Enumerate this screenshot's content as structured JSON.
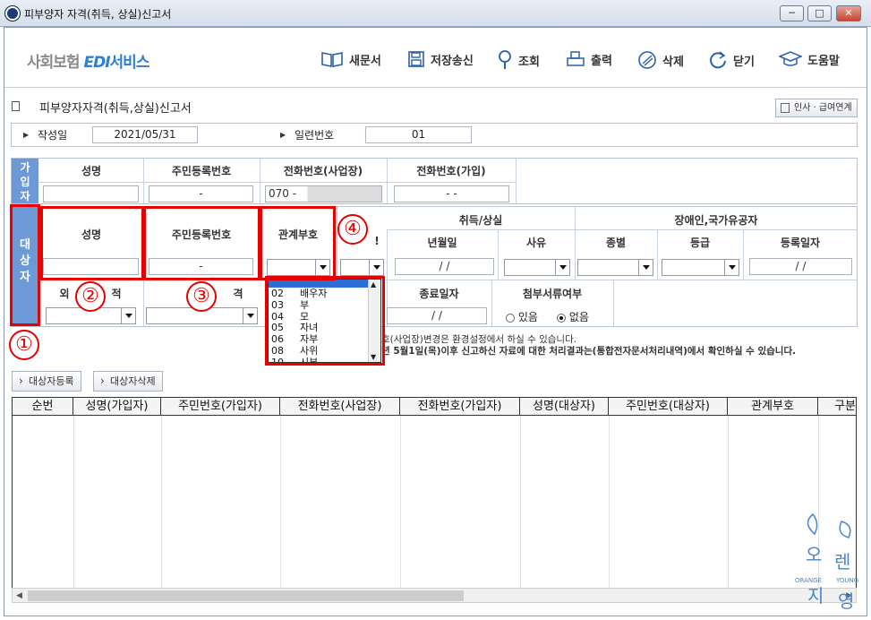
{
  "window": {
    "title": "피부양자 자격(취득, 상실)신고서",
    "buttons": [
      "─",
      "□",
      "✕"
    ]
  },
  "logo": {
    "prefix": "사회보험 ",
    "edi": "EDI",
    "suffix": "서비스"
  },
  "toolbar": [
    {
      "label": "새문서",
      "icon": "book-icon"
    },
    {
      "label": "저장송신",
      "icon": "save-icon"
    },
    {
      "label": "조회",
      "icon": "search-icon"
    },
    {
      "label": "출력",
      "icon": "print-icon"
    },
    {
      "label": "삭제",
      "icon": "delete-icon"
    },
    {
      "label": "닫기",
      "icon": "refresh-icon"
    },
    {
      "label": "도움말",
      "icon": "graduation-cap-icon"
    }
  ],
  "form": {
    "title": "피부양자자격(취득,상실)신고서",
    "link_button": "인사 · 급여연계",
    "created_label": "작성일",
    "created_value": "2021/05/31",
    "serial_label": "일련번호",
    "serial_value": "01"
  },
  "subscriber": {
    "side_label": "가입자",
    "headers": [
      "성명",
      "주민등록번호",
      "전화번호(사업장)",
      "전화번호(가입)"
    ],
    "rrn_value": "-",
    "phone_biz_prefix": "070  -",
    "phone_sub_value": "-        -"
  },
  "target": {
    "side_label": "대상자",
    "headers": {
      "name": "성명",
      "rrn": "주민등록번호",
      "relation": "관계부호",
      "acq_loss": "취득/상실",
      "date": "년월일",
      "reason": "사유",
      "disability": "장애인,국가유공자",
      "type": "종별",
      "grade": "등급",
      "reg_date": "등록일자"
    },
    "rrn_value": "-",
    "date_value": "/  /",
    "reg_date_value": "/  /",
    "row2": {
      "foreigner": "외",
      "nationality": "적",
      "stay": "격",
      "end_date_label": "종료일자",
      "end_date_value": "/  /",
      "attach_label": "첨부서류여부",
      "attach_yes": "있음",
      "attach_no": "없음"
    },
    "partial_bang": "!"
  },
  "relation_options": [
    {
      "code": "02",
      "name": "배우자"
    },
    {
      "code": "03",
      "name": "부"
    },
    {
      "code": "04",
      "name": "모"
    },
    {
      "code": "05",
      "name": "자녀"
    },
    {
      "code": "06",
      "name": "자부"
    },
    {
      "code": "08",
      "name": "사위"
    },
    {
      "code": "10",
      "name": "시부"
    }
  ],
  "notes": [
    "호(사업장)변경은 환경설정에서 하실 수 있습니다.",
    "년 5월1일(목)이후 신고하신 자료에 대한 처리결과는(통합전자문서처리내역)에서 확인하실 수 있습니다."
  ],
  "buttons": {
    "register": "대상자등록",
    "delete": "대상자삭제"
  },
  "table": {
    "columns": [
      "순번",
      "성명(가입자)",
      "주민번호(가입자)",
      "전화번호(사업장)",
      "전화번호(가입자)",
      "성명(대상자)",
      "주민번호(대상자)",
      "관계부호",
      "구분"
    ]
  },
  "annotations": [
    "①",
    "②",
    "③",
    "④"
  ],
  "watermark": {
    "text1": "오",
    "text2": "렌",
    "text3": "지",
    "text4": "영",
    "brand_left": "ORANGE",
    "brand_right": "YOUNG"
  }
}
